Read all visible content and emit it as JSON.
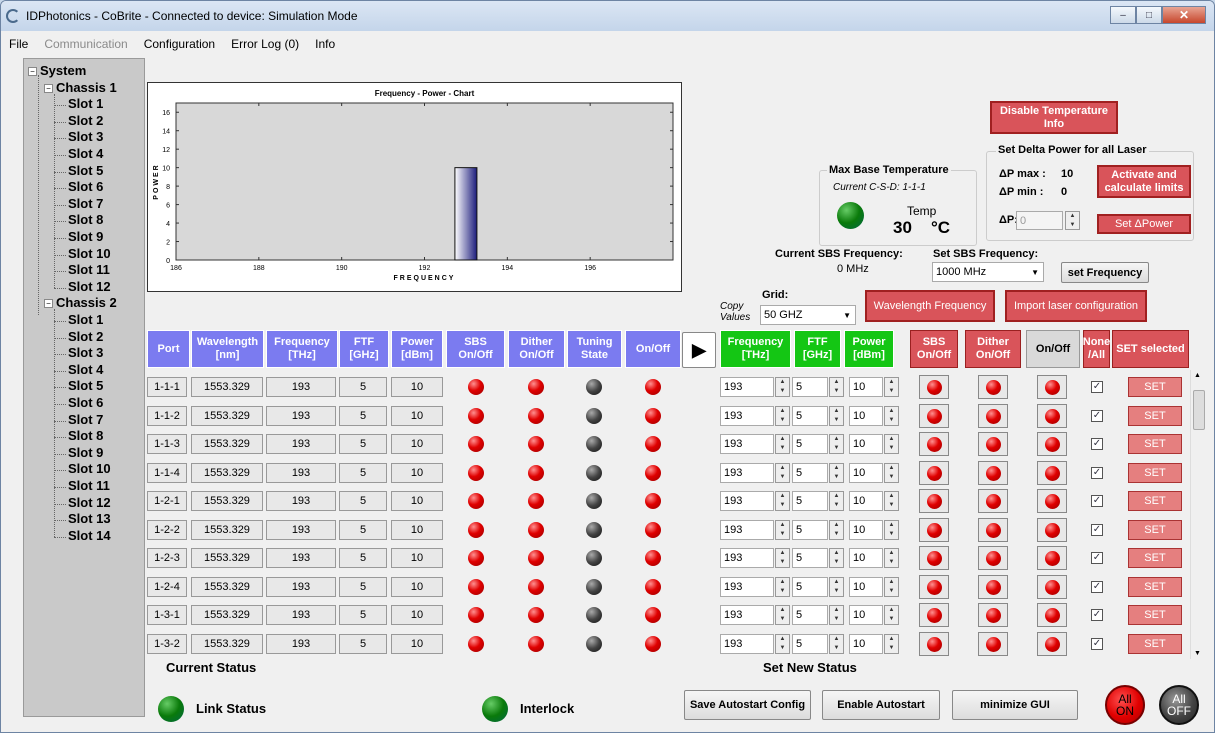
{
  "window": {
    "title": "IDPhotonics - CoBrite - Connected to device: Simulation Mode",
    "min": "–",
    "max": "□",
    "close": "✕"
  },
  "menu": [
    "File",
    "Communication",
    "Configuration",
    "Error Log (0)",
    "Info"
  ],
  "tree": {
    "root": "System",
    "chassis": [
      {
        "label": "Chassis 1",
        "slots": [
          "Slot 1",
          "Slot 2",
          "Slot 3",
          "Slot 4",
          "Slot 5",
          "Slot 6",
          "Slot 7",
          "Slot 8",
          "Slot 9",
          "Slot 10",
          "Slot 11",
          "Slot 12"
        ]
      },
      {
        "label": "Chassis 2",
        "slots": [
          "Slot 1",
          "Slot 2",
          "Slot 3",
          "Slot 4",
          "Slot 5",
          "Slot 6",
          "Slot 7",
          "Slot 8",
          "Slot 9",
          "Slot 10",
          "Slot 11",
          "Slot 12",
          "Slot 13",
          "Slot 14"
        ]
      }
    ]
  },
  "chart_data": {
    "type": "bar",
    "title": "Frequency - Power - Chart",
    "xlabel": "FREQUENCY",
    "ylabel": "POWER",
    "xlim": [
      186,
      198
    ],
    "ylim": [
      0,
      17
    ],
    "xticks": [
      186,
      188,
      190,
      192,
      194,
      196
    ],
    "yticks": [
      0,
      2,
      4,
      6,
      8,
      10,
      12,
      14,
      16
    ],
    "bars": [
      {
        "x": 193,
        "y": 10
      }
    ]
  },
  "temperature": {
    "disable_btn": "Disable Temperature Info",
    "group": "Max Base Temperature",
    "current": "Current C-S-D:  1-1-1",
    "temp_label": "Temp",
    "value": "30",
    "unit": "°C"
  },
  "delta_power": {
    "group": "Set Delta Power for all Laser",
    "max_label": "ΔP max :",
    "max_value": "10",
    "min_label": "ΔP min :",
    "min_value": "0",
    "activate_btn": "Activate and calculate limits",
    "dp_label": "ΔP:",
    "dp_value": "0",
    "set_btn": "Set ΔPower"
  },
  "sbs": {
    "current_label": "Current SBS Frequency:",
    "current_value": "0 MHz",
    "set_label": "Set SBS Frequency:",
    "set_value": "1000 MHz",
    "set_btn": "set Frequency"
  },
  "grid": {
    "label": "Grid:",
    "value": "50 GHZ",
    "copy": "Copy Values",
    "wavelength_btn": "Wavelength Frequency",
    "import_btn": "Import laser configuration"
  },
  "current_headers": [
    "Port",
    "Wavelength [nm]",
    "Frequency [THz]",
    "FTF [GHz]",
    "Power [dBm]",
    "SBS On/Off",
    "Dither On/Off",
    "Tuning State",
    "On/Off"
  ],
  "new_headers": [
    "Frequency [THz]",
    "FTF [GHz]",
    "Power [dBm]",
    "SBS On/Off",
    "Dither On/Off",
    "On/Off",
    "None /All",
    "SET selected"
  ],
  "rows": [
    {
      "port": "1-1-1",
      "wl": "1553.329",
      "freq": "193",
      "ftf": "5",
      "power": "10",
      "nfreq": "193",
      "nftf": "5",
      "npow": "10",
      "set": "SET"
    },
    {
      "port": "1-1-2",
      "wl": "1553.329",
      "freq": "193",
      "ftf": "5",
      "power": "10",
      "nfreq": "193",
      "nftf": "5",
      "npow": "10",
      "set": "SET"
    },
    {
      "port": "1-1-3",
      "wl": "1553.329",
      "freq": "193",
      "ftf": "5",
      "power": "10",
      "nfreq": "193",
      "nftf": "5",
      "npow": "10",
      "set": "SET"
    },
    {
      "port": "1-1-4",
      "wl": "1553.329",
      "freq": "193",
      "ftf": "5",
      "power": "10",
      "nfreq": "193",
      "nftf": "5",
      "npow": "10",
      "set": "SET"
    },
    {
      "port": "1-2-1",
      "wl": "1553.329",
      "freq": "193",
      "ftf": "5",
      "power": "10",
      "nfreq": "193",
      "nftf": "5",
      "npow": "10",
      "set": "SET"
    },
    {
      "port": "1-2-2",
      "wl": "1553.329",
      "freq": "193",
      "ftf": "5",
      "power": "10",
      "nfreq": "193",
      "nftf": "5",
      "npow": "10",
      "set": "SET"
    },
    {
      "port": "1-2-3",
      "wl": "1553.329",
      "freq": "193",
      "ftf": "5",
      "power": "10",
      "nfreq": "193",
      "nftf": "5",
      "npow": "10",
      "set": "SET"
    },
    {
      "port": "1-2-4",
      "wl": "1553.329",
      "freq": "193",
      "ftf": "5",
      "power": "10",
      "nfreq": "193",
      "nftf": "5",
      "npow": "10",
      "set": "SET"
    },
    {
      "port": "1-3-1",
      "wl": "1553.329",
      "freq": "193",
      "ftf": "5",
      "power": "10",
      "nfreq": "193",
      "nftf": "5",
      "npow": "10",
      "set": "SET"
    },
    {
      "port": "1-3-2",
      "wl": "1553.329",
      "freq": "193",
      "ftf": "5",
      "power": "10",
      "nfreq": "193",
      "nftf": "5",
      "npow": "10",
      "set": "SET"
    }
  ],
  "status": {
    "current": "Current Status",
    "new": "Set New Status",
    "link": "Link Status",
    "interlock": "Interlock"
  },
  "bottom": {
    "save": "Save Autostart Config",
    "enable": "Enable Autostart",
    "minimize": "minimize GUI",
    "all_on": "All ON",
    "all_off": "All OFF"
  },
  "colors": {
    "blue_header": "#7b7bf0",
    "green_header": "#14c614",
    "red_button": "#d9545a"
  }
}
